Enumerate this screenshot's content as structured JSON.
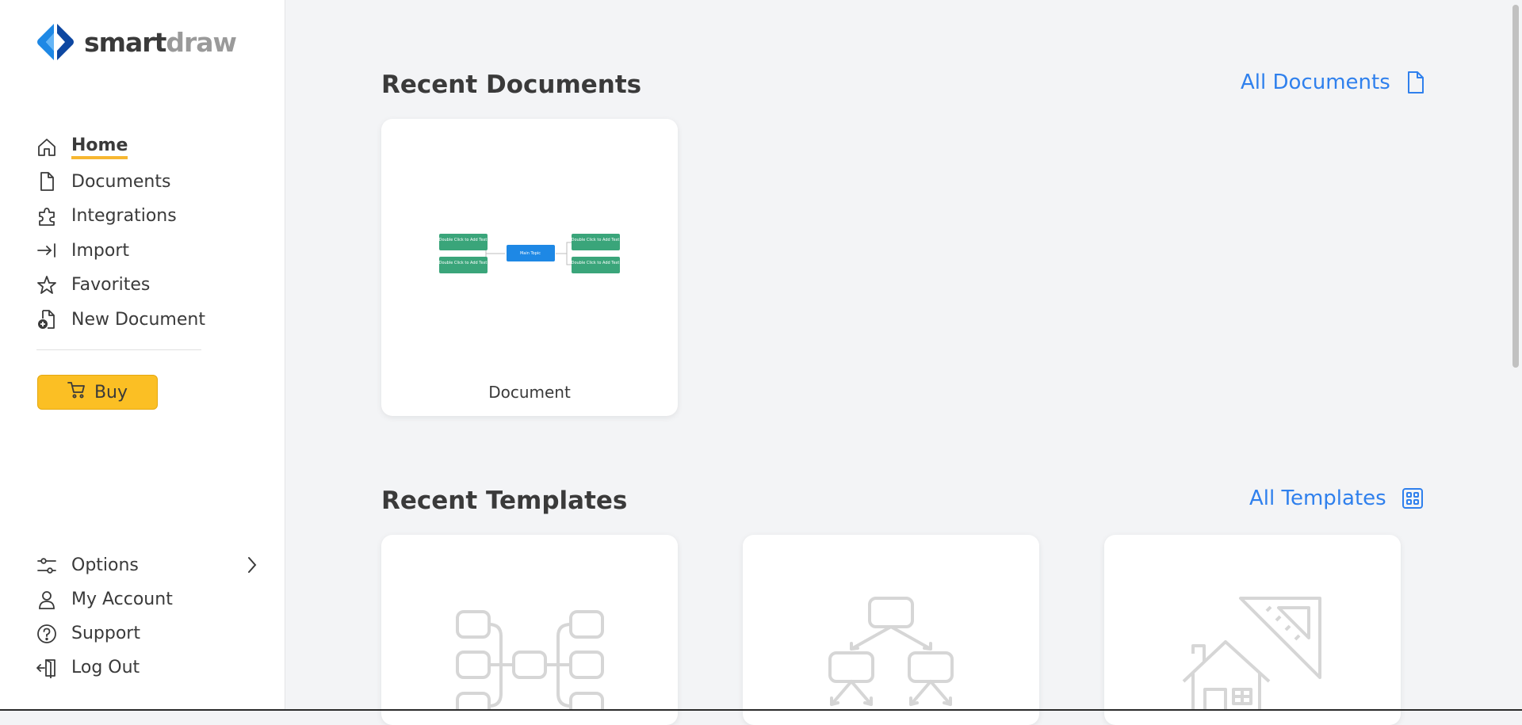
{
  "app": {
    "logo_smart": "smart",
    "logo_draw": "draw"
  },
  "sidebar": {
    "items": [
      {
        "label": "Home",
        "active": true
      },
      {
        "label": "Documents"
      },
      {
        "label": "Integrations"
      },
      {
        "label": "Import"
      },
      {
        "label": "Favorites"
      },
      {
        "label": "New Document"
      }
    ],
    "buy_label": "Buy",
    "bottom_items": [
      {
        "label": "Options"
      },
      {
        "label": "My Account"
      },
      {
        "label": "Support"
      },
      {
        "label": "Log Out"
      }
    ]
  },
  "recent_documents": {
    "title": "Recent Documents",
    "link_label": "All Documents",
    "items": [
      {
        "caption": "Document",
        "thumb_main": "Main Topic",
        "thumb_child": "Double Click to Add Text"
      }
    ]
  },
  "recent_templates": {
    "title": "Recent Templates",
    "link_label": "All Templates"
  },
  "colors": {
    "accent": "#2f80ed",
    "buy": "#fbbf24",
    "active_underline": "#f7b731",
    "thumb_green": "#3aa57a",
    "thumb_blue": "#1e88e5"
  }
}
